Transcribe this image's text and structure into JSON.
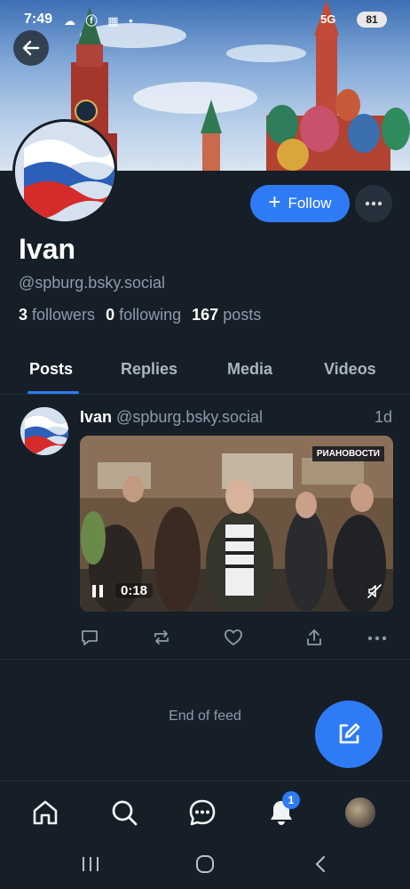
{
  "status_bar": {
    "time": "7:49",
    "left_icons": "☁ ⓕ ▦ •",
    "network": "5G",
    "battery": "81"
  },
  "profile": {
    "display_name": "Ivan",
    "handle": "@spburg.bsky.social",
    "followers_count": "3",
    "followers_label": "followers",
    "following_count": "0",
    "following_label": "following",
    "posts_count": "167",
    "posts_label": "posts",
    "follow_label": "Follow"
  },
  "tabs": [
    {
      "label": "Posts",
      "active": true
    },
    {
      "label": "Replies",
      "active": false
    },
    {
      "label": "Media",
      "active": false
    },
    {
      "label": "Videos",
      "active": false
    }
  ],
  "post": {
    "author": "Ivan",
    "handle": "@spburg.bsky.social",
    "time": "1d",
    "video": {
      "watermark": "РИАНОВОСТИ",
      "duration": "0:18",
      "playing": true,
      "muted": true
    },
    "actions": [
      "reply-icon",
      "repost-icon",
      "like-icon",
      "share-icon",
      "more-icon"
    ]
  },
  "feed": {
    "end_text": "End of feed"
  },
  "bottom_nav": {
    "items": [
      "home-icon",
      "search-icon",
      "chat-icon",
      "notifications-icon",
      "profile-avatar"
    ],
    "notification_count": "1"
  },
  "colors": {
    "background": "#161e27",
    "accent": "#2f7bf5",
    "muted_text": "#8d9bab"
  }
}
